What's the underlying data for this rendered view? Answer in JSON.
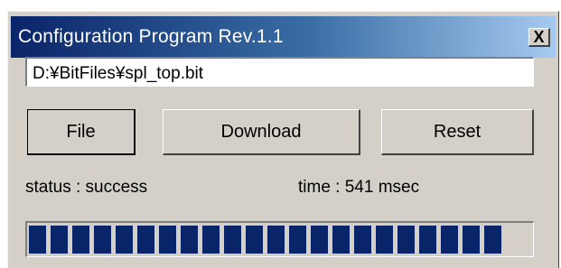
{
  "window": {
    "title": "Configuration Program  Rev.1.1",
    "close_label": "X"
  },
  "file_path": {
    "value": "D:¥BitFiles¥spl_top.bit"
  },
  "buttons": {
    "file": "File",
    "download": "Download",
    "reset": "Reset"
  },
  "status": {
    "text": "status : success"
  },
  "time": {
    "text": "time : 541  msec"
  },
  "progress": {
    "fraction": 1.0,
    "block_count": 22,
    "color": "#0a246a"
  },
  "colors": {
    "title_start": "#0a246a",
    "title_end": "#a6caf0",
    "face": "#d4d0c8"
  }
}
